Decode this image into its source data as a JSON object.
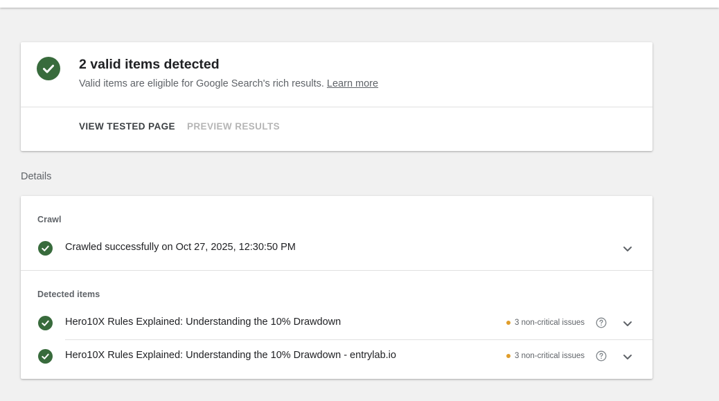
{
  "summary": {
    "title": "2 valid items detected",
    "subtitle": "Valid items are eligible for Google Search's rich results.",
    "learn_more": "Learn more",
    "view_tested_page": "VIEW TESTED PAGE",
    "preview_results": "PREVIEW RESULTS"
  },
  "details": {
    "label": "Details",
    "crawl": {
      "heading": "Crawl",
      "status": "Crawled successfully on Oct 27, 2025, 12:30:50 PM"
    },
    "detected": {
      "heading": "Detected items",
      "items": [
        {
          "title": "Hero10X Rules Explained: Understanding the 10% Drawdown",
          "issues": "3 non-critical issues"
        },
        {
          "title": "Hero10X Rules Explained: Understanding the 10% Drawdown - entrylab.io",
          "issues": "3 non-critical issues"
        }
      ]
    }
  },
  "colors": {
    "success": "#386b3c",
    "warning": "#e09d2b"
  },
  "icons": [
    "check-circle-icon",
    "chevron-down-icon",
    "help-circle-icon"
  ]
}
